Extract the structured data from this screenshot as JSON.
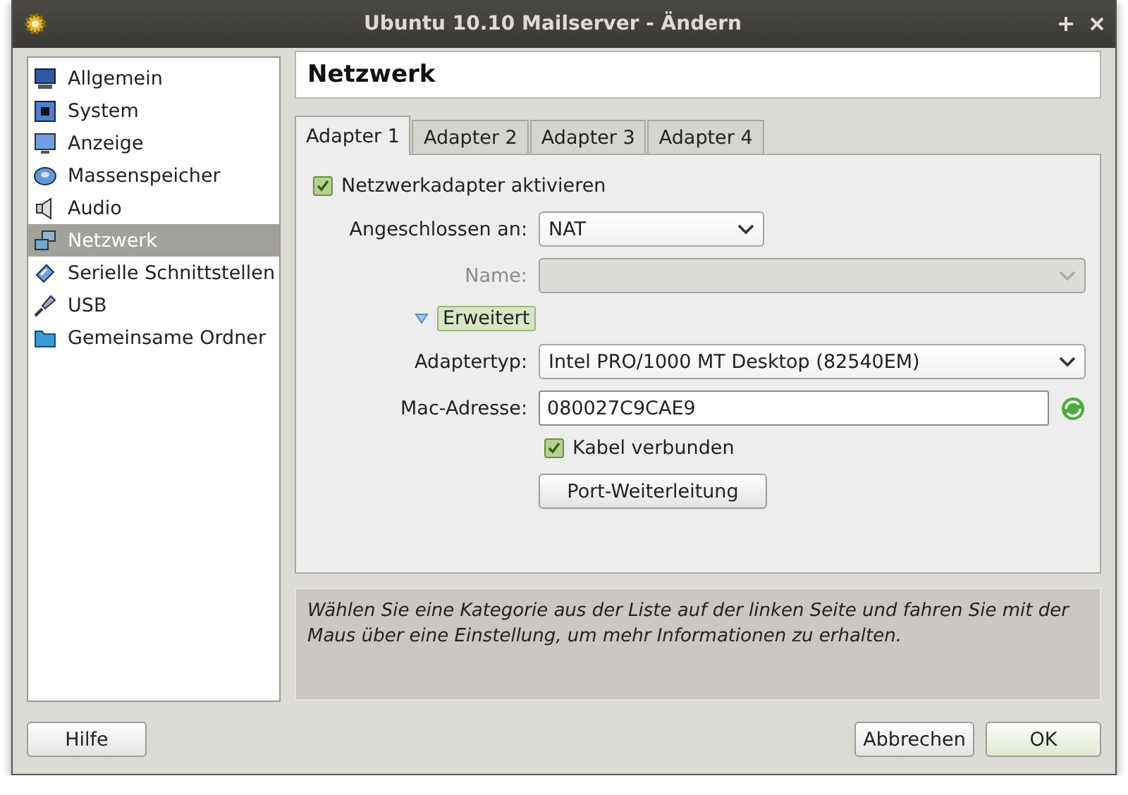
{
  "window": {
    "title": "Ubuntu 10.10 Mailserver - Ändern"
  },
  "sidebar": {
    "items": [
      {
        "label": "Allgemein",
        "selected": false
      },
      {
        "label": "System",
        "selected": false
      },
      {
        "label": "Anzeige",
        "selected": false
      },
      {
        "label": "Massenspeicher",
        "selected": false
      },
      {
        "label": "Audio",
        "selected": false
      },
      {
        "label": "Netzwerk",
        "selected": true
      },
      {
        "label": "Serielle Schnittstellen",
        "selected": false
      },
      {
        "label": "USB",
        "selected": false
      },
      {
        "label": "Gemeinsame Ordner",
        "selected": false
      }
    ]
  },
  "page_title": "Netzwerk",
  "tabs": [
    {
      "label": "Adapter 1",
      "selected": true
    },
    {
      "label": "Adapter 2",
      "selected": false
    },
    {
      "label": "Adapter 3",
      "selected": false
    },
    {
      "label": "Adapter 4",
      "selected": false
    }
  ],
  "enable_adapter": {
    "label": "Netzwerkadapter aktivieren",
    "checked": true
  },
  "attached_to": {
    "label": "Angeschlossen an:",
    "value": "NAT",
    "disabled": false
  },
  "name": {
    "label": "Name:",
    "disabled": true
  },
  "advanced": {
    "label": "Erweitert",
    "expanded": true
  },
  "adapter_type": {
    "label": "Adaptertyp:",
    "value": "Intel PRO/1000 MT Desktop (82540EM)",
    "disabled": false
  },
  "mac_address": {
    "label": "Mac-Adresse:",
    "value": "080027C9CAE9"
  },
  "cable_connected": {
    "label": "Kabel verbunden",
    "checked": true
  },
  "port_forwarding_button": "Port-Weiterleitung",
  "info_text": "Wählen Sie eine Kategorie aus der Liste auf der linken Seite und fahren Sie mit der Maus über eine Einstellung, um mehr Informationen zu erhalten.",
  "buttons": {
    "help": "Hilfe",
    "cancel": "Abbrechen",
    "ok": "OK"
  }
}
